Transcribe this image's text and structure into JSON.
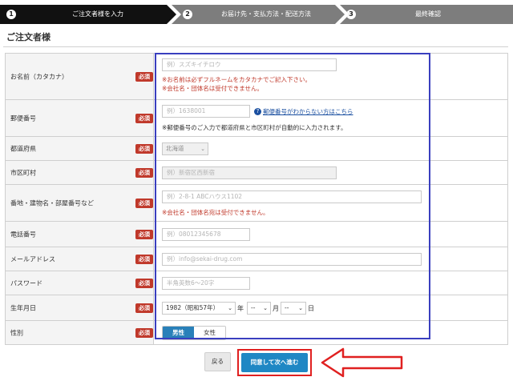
{
  "steps": [
    {
      "num": "1",
      "label": "ご注文者様を入力"
    },
    {
      "num": "2",
      "label": "お届け先・支払方法・配送方法"
    },
    {
      "num": "3",
      "label": "最終確認"
    }
  ],
  "section_title": "ご注文者様",
  "required_badge": "必須",
  "fields": {
    "name": {
      "label": "お名前（カタカナ）",
      "placeholder": "例）スズキイチロウ",
      "note1": "※お名前は必ずフルネームをカタカナでご記入下さい。",
      "note2": "※会社名・団体名は受付できません。"
    },
    "zip": {
      "label": "郵便番号",
      "placeholder": "例）1638001",
      "help_text": "郵便番号がわからない方はこちら",
      "note": "※郵便番号のご入力で都道府県と市区町村が自動的に入力されます。"
    },
    "pref": {
      "label": "都道府県",
      "value": "北海道"
    },
    "city": {
      "label": "市区町村",
      "placeholder": "例）新宿区西新宿"
    },
    "address": {
      "label": "番地・建物名・部屋番号など",
      "placeholder": "例）2-8-1 ABCハウス1102",
      "note": "※会社名・団体名宛は受付できません。"
    },
    "phone": {
      "label": "電話番号",
      "placeholder": "例）08012345678"
    },
    "email": {
      "label": "メールアドレス",
      "placeholder": "例）info@sekai-drug.com"
    },
    "password": {
      "label": "パスワード",
      "placeholder": "半角英数6～20字"
    },
    "birthday": {
      "label": "生年月日",
      "year": "1982（昭和57年）",
      "year_unit": "年",
      "month": "--",
      "month_unit": "月",
      "day": "--",
      "day_unit": "日"
    },
    "gender": {
      "label": "性別",
      "options": [
        "男性",
        "女性"
      ],
      "selected": "男性"
    }
  },
  "buttons": {
    "back": "戻る",
    "next": "同意して次へ進む"
  },
  "colors": {
    "required": "#c0392b",
    "primary": "#1f87c4",
    "highlight_box": "#3a3fbf",
    "arrow": "#e02020"
  }
}
